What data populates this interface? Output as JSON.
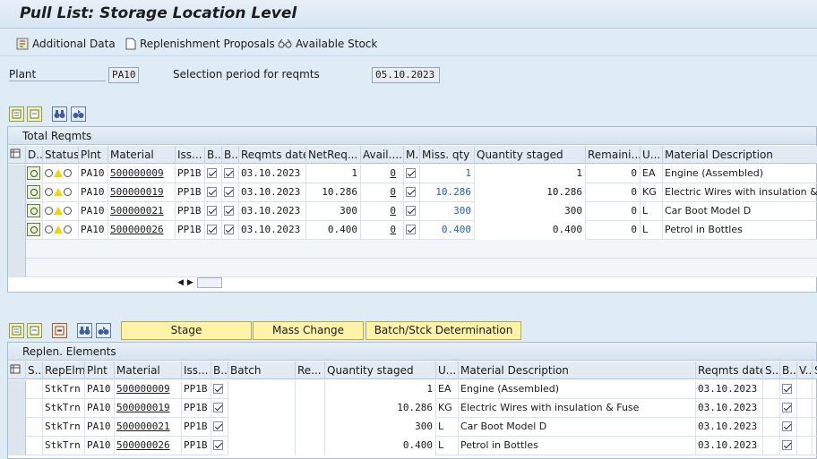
{
  "title": "Pull List: Storage Location Level",
  "appbar": {
    "additional_data": "Additional Data",
    "replenishment_proposals": "Replenishment Proposals",
    "available_stock": "Available Stock"
  },
  "selection": {
    "plant_label": "Plant",
    "plant_value": "PA10",
    "period_label": "Selection period for reqmts",
    "period_value": "05.10.2023"
  },
  "total": {
    "title": "Total Reqmts",
    "headers": [
      "D..",
      "Status",
      "Plnt",
      "Material",
      "Iss...",
      "B..",
      "B..",
      "Reqmts date",
      "NetReq...",
      "Avail....",
      "M..",
      "Miss. qty",
      "Quantity staged",
      "Remaini...",
      "U...",
      "Material Description"
    ],
    "rows": [
      {
        "plnt": "PA10",
        "material": "500000009",
        "iss": "PP1B",
        "b1": true,
        "b2": true,
        "date": "03.10.2023",
        "netreq": "1",
        "avail": "0",
        "m": true,
        "miss": "1",
        "staged": "1",
        "remain": "0",
        "unit": "EA",
        "desc": "Engine (Assembled)"
      },
      {
        "plnt": "PA10",
        "material": "500000019",
        "iss": "PP1B",
        "b1": true,
        "b2": true,
        "date": "03.10.2023",
        "netreq": "10.286",
        "avail": "0",
        "m": true,
        "miss": "10.286",
        "staged": "10.286",
        "remain": "0",
        "unit": "KG",
        "desc": "Electric Wires with insulation & F"
      },
      {
        "plnt": "PA10",
        "material": "500000021",
        "iss": "PP1B",
        "b1": true,
        "b2": true,
        "date": "03.10.2023",
        "netreq": "300",
        "avail": "0",
        "m": true,
        "miss": "300",
        "staged": "300",
        "remain": "0",
        "unit": "L",
        "desc": "Car Boot Model D"
      },
      {
        "plnt": "PA10",
        "material": "500000026",
        "iss": "PP1B",
        "b1": true,
        "b2": true,
        "date": "03.10.2023",
        "netreq": "0.400",
        "avail": "0",
        "m": true,
        "miss": "0.400",
        "staged": "0.400",
        "remain": "0",
        "unit": "L",
        "desc": "Petrol in Bottles"
      }
    ]
  },
  "buttons": {
    "stage": "Stage",
    "mass_change": "Mass Change",
    "batch_determination": "Batch/Stck Determination"
  },
  "replen": {
    "title": "Replen. Elements",
    "headers": [
      "S..",
      "RepElm",
      "Plnt",
      "Material",
      "Iss...",
      "B..",
      "Batch",
      "Re...",
      "Quantity staged",
      "U...",
      "Material Description",
      "Reqmts date",
      "S..",
      "B..",
      "V..",
      "S"
    ],
    "rows": [
      {
        "repelm": "StkTrn",
        "plnt": "PA10",
        "material": "500000009",
        "iss": "PP1B",
        "b": true,
        "staged": "1",
        "unit": "EA",
        "desc": "Engine (Assembled)",
        "date": "03.10.2023",
        "b2": true
      },
      {
        "repelm": "StkTrn",
        "plnt": "PA10",
        "material": "500000019",
        "iss": "PP1B",
        "b": true,
        "staged": "10.286",
        "unit": "KG",
        "desc": "Electric Wires with insulation & Fuse",
        "date": "03.10.2023",
        "b2": true
      },
      {
        "repelm": "StkTrn",
        "plnt": "PA10",
        "material": "500000021",
        "iss": "PP1B",
        "b": true,
        "staged": "300",
        "unit": "L",
        "desc": "Car Boot Model D",
        "date": "03.10.2023",
        "b2": true
      },
      {
        "repelm": "StkTrn",
        "plnt": "PA10",
        "material": "500000026",
        "iss": "PP1B",
        "b": true,
        "staged": "0.400",
        "unit": "L",
        "desc": "Petrol in Bottles",
        "date": "03.10.2023",
        "b2": true
      }
    ]
  }
}
